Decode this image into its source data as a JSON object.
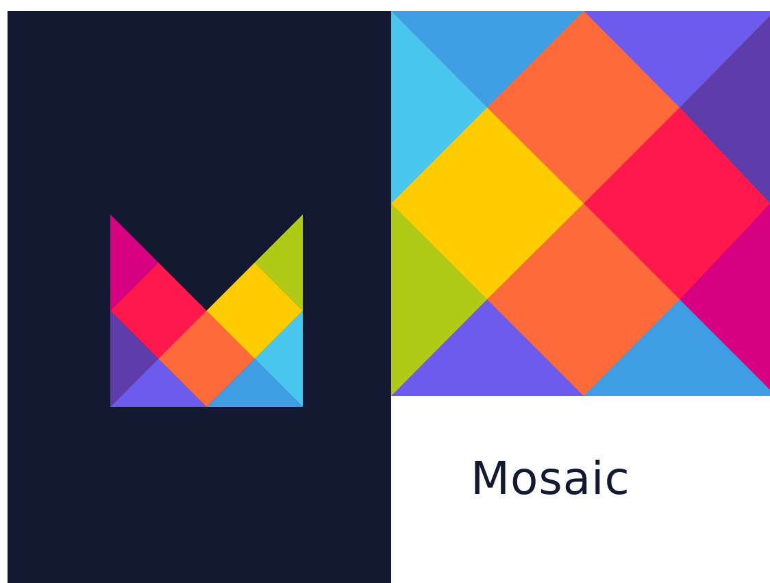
{
  "brand": {
    "name": "Mosaic",
    "text_color": "#131931",
    "background_dark": "#131931",
    "background_light": "#ffffff"
  },
  "logo": {
    "icon": "mosaic-m-logo-icon"
  },
  "pattern": {
    "icon": "mosaic-diamond-pattern"
  },
  "palette": {
    "blue": "#3F9DE3",
    "cyan": "#48C6EE",
    "purple": "#6D5BEE",
    "deep_purple": "#5E3CAA",
    "orange": "#FF6A3A",
    "red": "#FF184C",
    "yellow": "#FFCC00",
    "lime": "#AFCB16",
    "magenta": "#D60081"
  }
}
